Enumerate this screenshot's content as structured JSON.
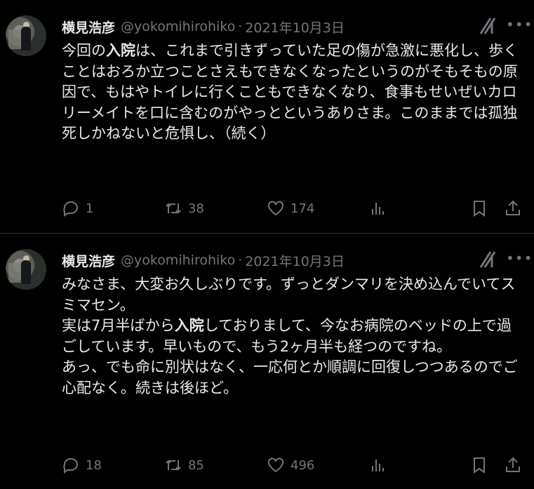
{
  "tweets": [
    {
      "author": {
        "name": "横見浩彦",
        "handle": "@yokomihirohiko",
        "separator": "·",
        "date": "2021年10月3日"
      },
      "text_parts": [
        "今回の",
        "入院",
        "は、これまで引きずっていた足の傷が急激に悪化し、歩くことはおろか立つことさえもできなくなったというのがそもそもの原因で、もはやトイレに行くこともできなくなり、食事もせいぜいカロリーメイトを口に含むのがやっとというありさま。このままでは孤独死しかねないと危惧し、（続く）"
      ],
      "stats": {
        "replies": "1",
        "retweets": "38",
        "likes": "174"
      }
    },
    {
      "author": {
        "name": "横見浩彦",
        "handle": "@yokomihirohiko",
        "separator": "·",
        "date": "2021年10月3日"
      },
      "text_parts": [
        "みなさま、大変お久しぶりです。ずっとダンマリを決め込んでいてスミマセン。\n実は7月半ばから",
        "入院",
        "しておりまして、今なお病院のベッドの上で過ごしています。早いもので、もう2ヶ月半も経つのですね。\nあっ、でも命に別状はなく、一応何とか順調に回復しつつあるのでご心配なく。続きは後ほど。"
      ],
      "stats": {
        "replies": "18",
        "retweets": "85",
        "likes": "496"
      }
    }
  ],
  "icons": [
    "grok-icon",
    "more-icon",
    "reply-icon",
    "retweet-icon",
    "like-icon",
    "views-icon",
    "bookmark-icon",
    "share-icon"
  ],
  "colors": {
    "background": "#000000",
    "text": "#e7e9ea",
    "muted": "#71767b",
    "divider": "#2f3336"
  }
}
